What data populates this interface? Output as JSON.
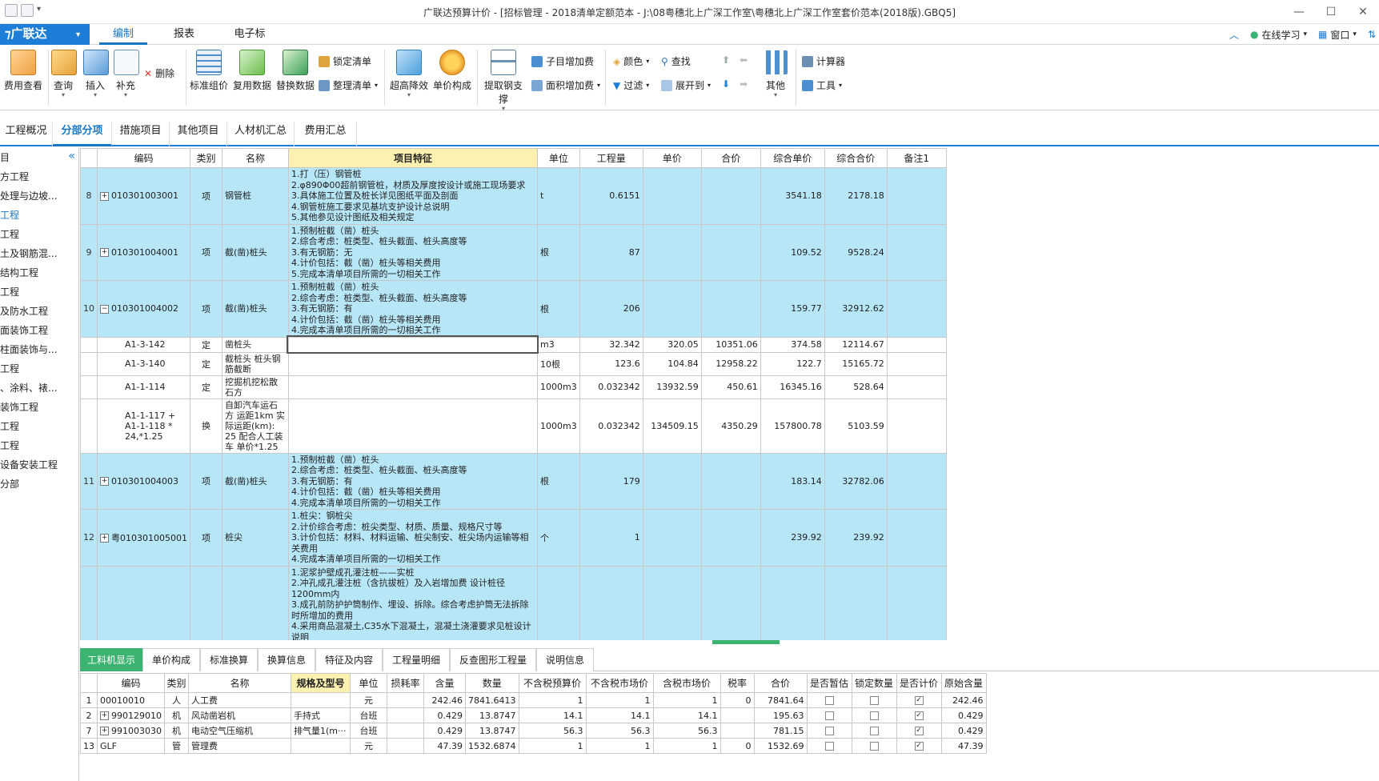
{
  "window": {
    "title": "广联达预算计价 - [招标管理 - 2018清单定额范本 - J:\\08粤穗北上广深工作室\\粤穗北上广深工作室套价范本(2018版).GBQ5]"
  },
  "brand": {
    "name": "广联达"
  },
  "menu": {
    "tabs": [
      "编制",
      "报表",
      "电子标"
    ],
    "right": {
      "online": "在线学习",
      "window": "窗口"
    }
  },
  "ribbon": {
    "buttons": [
      {
        "label": "费用查看",
        "icon": "cost-view-icon"
      },
      {
        "label": "查询",
        "icon": "query-icon"
      },
      {
        "label": "插入",
        "icon": "insert-icon"
      },
      {
        "label": "补充",
        "icon": "supplement-icon"
      },
      {
        "label": "删除",
        "icon": "delete-icon"
      },
      {
        "label": "标准组价",
        "icon": "standard-pricing-icon"
      },
      {
        "label": "复用数据",
        "icon": "reuse-data-icon"
      },
      {
        "label": "替换数据",
        "icon": "replace-data-icon"
      },
      {
        "label": "锁定清单",
        "icon": "lock-icon"
      },
      {
        "label": "整理清单",
        "icon": "organize-icon"
      },
      {
        "label": "超高降效",
        "icon": "height-reduction-icon"
      },
      {
        "label": "单价构成",
        "icon": "unit-price-icon"
      },
      {
        "label": "提取钢支撑",
        "icon": "steel-support-icon"
      },
      {
        "label": "子目增加费",
        "icon": "sub-item-fee-icon"
      },
      {
        "label": "面积增加费",
        "icon": "area-fee-icon"
      },
      {
        "label": "颜色",
        "icon": "color-icon"
      },
      {
        "label": "查找",
        "icon": "find-icon"
      },
      {
        "label": "过滤",
        "icon": "filter-icon"
      },
      {
        "label": "展开到",
        "icon": "expand-icon"
      },
      {
        "label": "其他",
        "icon": "other-icon"
      },
      {
        "label": "计算器",
        "icon": "calculator-icon"
      },
      {
        "label": "工具",
        "icon": "tools-icon"
      }
    ]
  },
  "tabs": [
    "工程概况",
    "分部分项",
    "措施项目",
    "其他项目",
    "人材机汇总",
    "费用汇总"
  ],
  "sidebar": {
    "items": [
      "目",
      "方工程",
      "处理与边坡...",
      "工程",
      "工程",
      "土及钢筋混...",
      "结构工程",
      "工程",
      "及防水工程",
      "面装饰工程",
      "柱面装饰与...",
      "工程",
      "、涂料、裱...",
      "装饰工程",
      "工程",
      "工程",
      "设备安装工程",
      "分部"
    ]
  },
  "grid": {
    "headers": [
      "编码",
      "类别",
      "名称",
      "项目特征",
      "单位",
      "工程量",
      "单价",
      "合价",
      "综合单价",
      "综合合价",
      "备注1"
    ],
    "rows": [
      {
        "no": "8",
        "code": "010301003001",
        "type": "项",
        "name": "钢管桩",
        "feature": "1.打（压）钢管桩\n2.φ890Φ00超前钢管桩，材质及厚度按设计或施工现场要求\n3.具体施工位置及桩长详见图纸平面及剖面\n4.钢管桩施工要求见基坑支护设计总说明\n5.其他参见设计图纸及相关规定",
        "unit": "t",
        "qty": "0.6151",
        "price": "",
        "total": "",
        "cprice": "3541.18",
        "ctotal": "2178.18"
      },
      {
        "no": "9",
        "code": "010301004001",
        "type": "项",
        "name": "截(凿)桩头",
        "feature": "1.预制桩截（凿）桩头\n2.综合考虑：桩类型、桩头截面、桩头高度等\n3.有无钢筋：无\n4.计价包括：截（凿）桩头等相关费用\n5.完成本清单项目所需的一切相关工作",
        "unit": "根",
        "qty": "87",
        "price": "",
        "total": "",
        "cprice": "109.52",
        "ctotal": "9528.24"
      },
      {
        "no": "10",
        "code": "010301004002",
        "type": "项",
        "name": "截(凿)桩头",
        "feature": "1.预制桩截（凿）桩头\n2.综合考虑：桩类型、桩头截面、桩头高度等\n3.有无钢筋：有\n4.计价包括：截（凿）桩头等相关费用\n4.完成本清单项目所需的一切相关工作",
        "unit": "根",
        "qty": "206",
        "price": "",
        "total": "",
        "cprice": "159.77",
        "ctotal": "32912.62"
      },
      {
        "no": "",
        "code": "A1-3-142",
        "type": "定",
        "name": "凿桩头",
        "feature": "",
        "unit": "m3",
        "qty": "32.342",
        "price": "320.05",
        "total": "10351.06",
        "cprice": "374.58",
        "ctotal": "12114.67"
      },
      {
        "no": "",
        "code": "A1-3-140",
        "type": "定",
        "name": "截桩头 桩头钢筋截断",
        "feature": "",
        "unit": "10根",
        "qty": "123.6",
        "price": "104.84",
        "total": "12958.22",
        "cprice": "122.7",
        "ctotal": "15165.72"
      },
      {
        "no": "",
        "code": "A1-1-114",
        "type": "定",
        "name": "挖掘机挖松散石方",
        "feature": "",
        "unit": "1000m3",
        "qty": "0.032342",
        "price": "13932.59",
        "total": "450.61",
        "cprice": "16345.16",
        "ctotal": "528.64"
      },
      {
        "no": "",
        "code": "A1-1-117 + A1-1-118 * 24,*1.25",
        "type": "换",
        "name": "自卸汽车运石方 运距1km 实际运距(km): 25 配合人工装车 单价*1.25",
        "feature": "",
        "unit": "1000m3",
        "qty": "0.032342",
        "price": "134509.15",
        "total": "4350.29",
        "cprice": "157800.78",
        "ctotal": "5103.59"
      },
      {
        "no": "11",
        "code": "010301004003",
        "type": "项",
        "name": "截(凿)桩头",
        "feature": "1.预制桩截（凿）桩头\n2.综合考虑：桩类型、桩头截面、桩头高度等\n3.有无钢筋：有\n4.计价包括：截（凿）桩头等相关费用\n4.完成本清单项目所需的一切相关工作",
        "unit": "根",
        "qty": "179",
        "price": "",
        "total": "",
        "cprice": "183.14",
        "ctotal": "32782.06"
      },
      {
        "no": "12",
        "code": "粤010301005001",
        "type": "项",
        "name": "桩尖",
        "feature": "1.桩尖：钢桩尖\n2.计价综合考虑：桩尖类型、材质、质量、规格尺寸等\n3.计价包括：材料、材料运输、桩尖制安、桩尖场内运输等相关费用\n4.完成本清单项目所需的一切相关工作",
        "unit": "个",
        "qty": "1",
        "price": "",
        "total": "",
        "cprice": "239.92",
        "ctotal": "239.92"
      },
      {
        "no": "",
        "code": "",
        "type": "",
        "name": "",
        "feature": "1.泥浆护壁成孔灌注桩——实桩\n2.冲孔成孔灌注桩（含抗拔桩）及入岩增加费 设计桩径 1200mm内\n3.成孔前防护护筒制作、埋设、拆除。综合考虑护筒无法拆除时所增加的费用\n4.采用商品混凝土,C35水下混凝土，混凝土浇灌要求见桩设计说明",
        "unit": "",
        "qty": "",
        "price": "",
        "total": "",
        "cprice": "",
        "ctotal": ""
      }
    ]
  },
  "bottom_tabs": [
    "工料机显示",
    "单价构成",
    "标准换算",
    "换算信息",
    "特征及内容",
    "工程量明细",
    "反查图形工程量",
    "说明信息"
  ],
  "bottom_grid": {
    "headers": [
      "编码",
      "类别",
      "名称",
      "规格及型号",
      "单位",
      "损耗率",
      "含量",
      "数量",
      "不含税预算价",
      "不含税市场价",
      "含税市场价",
      "税率",
      "合价",
      "是否暂估",
      "锁定数量",
      "是否计价",
      "原始含量"
    ],
    "rows": [
      {
        "no": "1",
        "code": "00010010",
        "type": "人",
        "name": "人工费",
        "spec": "",
        "unit": "元",
        "loss": "",
        "content": "242.46",
        "qty": "7841.6413",
        "pre": "1",
        "mkt": "1",
        "taxmkt": "1",
        "rate": "0",
        "total": "7841.64",
        "orig": "242.46"
      },
      {
        "no": "2",
        "code": "990129010",
        "type": "机",
        "name": "风动凿岩机",
        "spec": "手持式",
        "unit": "台班",
        "loss": "",
        "content": "0.429",
        "qty": "13.8747",
        "pre": "14.1",
        "mkt": "14.1",
        "taxmkt": "14.1",
        "rate": "",
        "total": "195.63",
        "orig": "0.429"
      },
      {
        "no": "7",
        "code": "991003030",
        "type": "机",
        "name": "电动空气压缩机",
        "spec": "排气量1(m···",
        "unit": "台班",
        "loss": "",
        "content": "0.429",
        "qty": "13.8747",
        "pre": "56.3",
        "mkt": "56.3",
        "taxmkt": "56.3",
        "rate": "",
        "total": "781.15",
        "orig": "0.429"
      },
      {
        "no": "13",
        "code": "GLF",
        "type": "管",
        "name": "管理费",
        "spec": "",
        "unit": "元",
        "loss": "",
        "content": "47.39",
        "qty": "1532.6874",
        "pre": "1",
        "mkt": "1",
        "taxmkt": "1",
        "rate": "0",
        "total": "1532.69",
        "orig": "47.39"
      }
    ]
  },
  "colors": {
    "accent": "#1c7ed6",
    "row_blue": "#b7e6f7",
    "header_highlight": "#fdf1b0",
    "green_tab": "#3cb371"
  }
}
